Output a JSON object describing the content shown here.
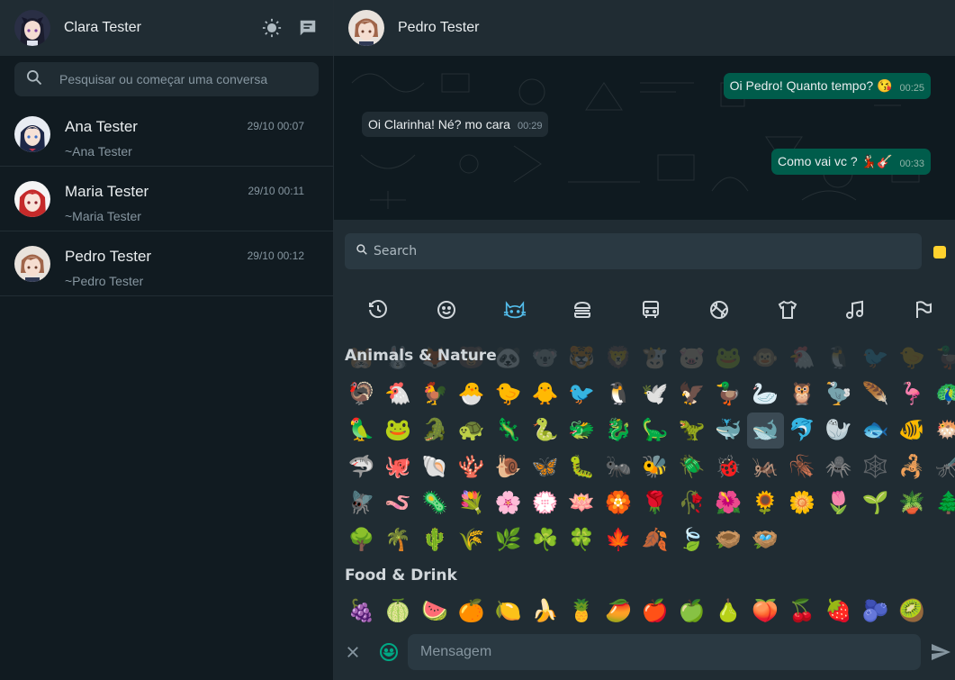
{
  "colors": {
    "accent": "#00a884",
    "panel": "#202c33",
    "background": "#111b21",
    "outgoing": "#005c4b",
    "active_category": "#53bdeb",
    "skin_tone": "#ffd22e"
  },
  "me": {
    "name": "Clara Tester",
    "avatar_icon": "anime-girl-avatar"
  },
  "header_icons": [
    "theme-toggle-sun-icon",
    "new-chat-icon"
  ],
  "search": {
    "placeholder": "Pesquisar ou começar uma conversa"
  },
  "chats": [
    {
      "name": "Ana Tester",
      "subtitle": "~Ana Tester",
      "time": "29/10 00:07"
    },
    {
      "name": "Maria Tester",
      "subtitle": "~Maria Tester",
      "time": "29/10 00:11"
    },
    {
      "name": "Pedro Tester",
      "subtitle": "~Pedro Tester",
      "time": "29/10 00:12"
    }
  ],
  "conversation": {
    "contact": "Pedro Tester",
    "messages": [
      {
        "text": "Oi Pedro! Quanto tempo? 😘",
        "time": "00:25",
        "direction": "out"
      },
      {
        "text": "Oi Clarinha! Né? mo cara",
        "time": "00:29",
        "direction": "in"
      },
      {
        "text": "Como vai vc ? 💃🏻🎸",
        "time": "00:33",
        "direction": "out"
      }
    ]
  },
  "emoji_picker": {
    "search_placeholder": "Search",
    "categories": [
      "recent-clock-icon",
      "smileys-icon",
      "animals-cat-icon",
      "food-burger-icon",
      "travel-bus-icon",
      "activities-ball-icon",
      "objects-shirt-icon",
      "symbols-music-icon",
      "flags-flag-icon"
    ],
    "active_category": "animals-cat-icon",
    "ghost_row": [
      "🐹",
      "🐰",
      "🦊",
      "🐻",
      "🐼",
      "🐨",
      "🐯",
      "🦁",
      "🐮",
      "🐷",
      "🐸",
      "🐵",
      "🐔",
      "🐧",
      "🐦",
      "🐤",
      "🦆"
    ],
    "sections": [
      {
        "title": "Animals & Nature",
        "emojis": [
          "🦃",
          "🐔",
          "🐓",
          "🐣",
          "🐤",
          "🐥",
          "🐦",
          "🐧",
          "🕊️",
          "🦅",
          "🦆",
          "🦢",
          "🦉",
          "🦤",
          "🪶",
          "🦩",
          "🦚",
          "🦜",
          "🐸",
          "🐊",
          "🐢",
          "🦎",
          "🐍",
          "🐲",
          "🐉",
          "🦕",
          "🦖",
          "🐳",
          "🐋",
          "🐬",
          "🦭",
          "🐟",
          "🐠",
          "🐡",
          "🦈",
          "🐙",
          "🐚",
          "🪸",
          "🐌",
          "🦋",
          "🐛",
          "🐜",
          "🐝",
          "🪲",
          "🐞",
          "🦗",
          "🪳",
          "🕷️",
          "🕸️",
          "🦂",
          "🦟",
          "🪰",
          "🪱",
          "🦠",
          "💐",
          "🌸",
          "💮",
          "🪷",
          "🏵️",
          "🌹",
          "🥀",
          "🌺",
          "🌻",
          "🌼",
          "🌷",
          "🌱",
          "🪴",
          "🌲",
          "🌳",
          "🌴",
          "🌵",
          "🌾",
          "🌿",
          "☘️",
          "🍀",
          "🍁",
          "🍂",
          "🍃",
          "🪹",
          "🪺"
        ],
        "selected_index": 28
      },
      {
        "title": "Food & Drink",
        "emojis": [
          "🍇",
          "🍈",
          "🍉",
          "🍊",
          "🍋",
          "🍌",
          "🍍",
          "🥭",
          "🍎",
          "🍏",
          "🍐",
          "🍑",
          "🍒",
          "🍓",
          "🫐",
          "🥝"
        ]
      }
    ]
  },
  "footer": {
    "placeholder": "Mensagem"
  }
}
